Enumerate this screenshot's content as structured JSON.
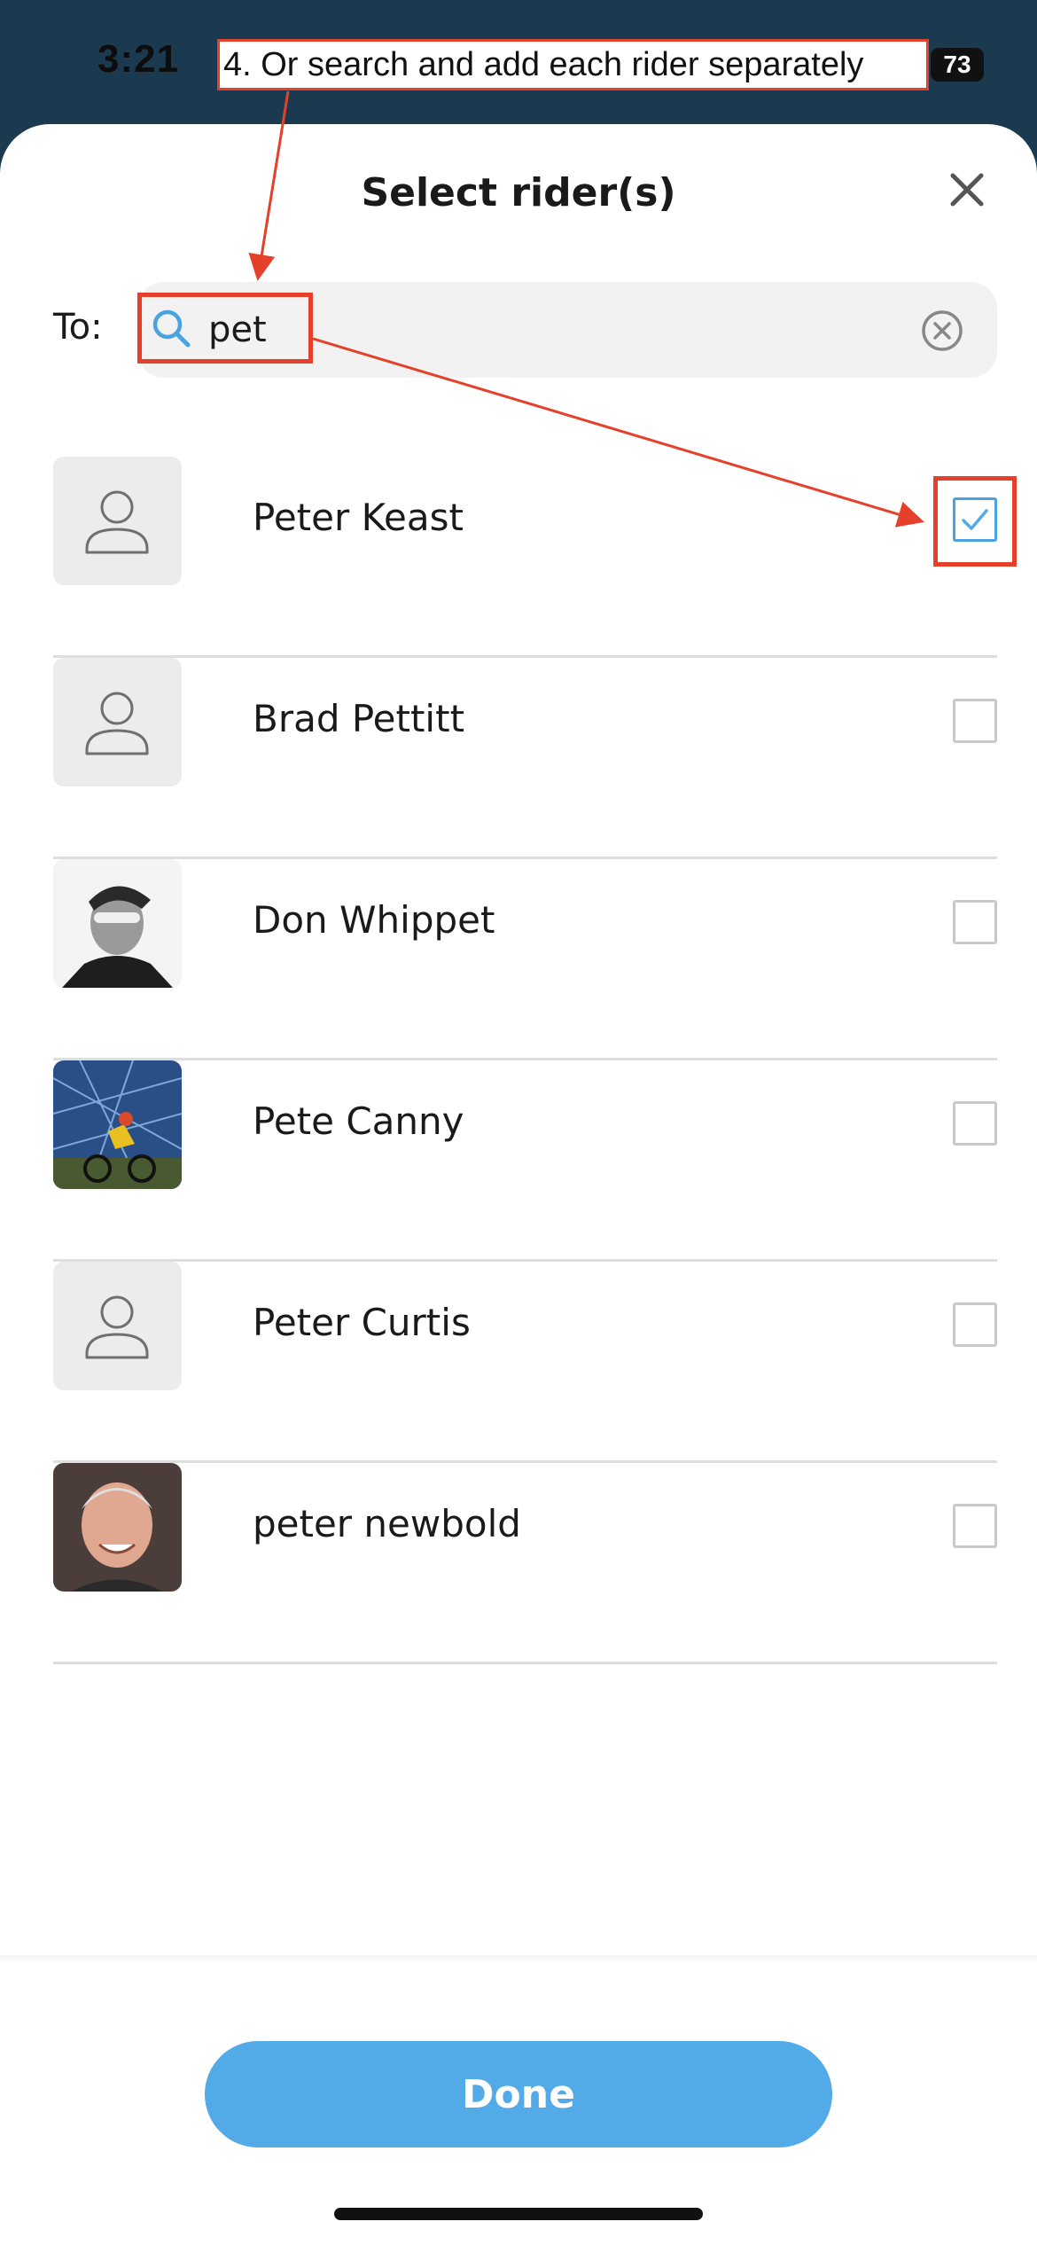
{
  "status_bar": {
    "time": "3:21",
    "battery": "73"
  },
  "annotation": {
    "text": "4. Or search and add each rider separately"
  },
  "sheet": {
    "title": "Select rider(s)"
  },
  "search": {
    "to_label": "To:",
    "query": "pet"
  },
  "riders": [
    {
      "name": "Peter Keast",
      "checked": true,
      "avatar": "placeholder"
    },
    {
      "name": "Brad Pettitt",
      "checked": false,
      "avatar": "placeholder"
    },
    {
      "name": "Don Whippet",
      "checked": false,
      "avatar": "photo"
    },
    {
      "name": "Pete Canny",
      "checked": false,
      "avatar": "photo"
    },
    {
      "name": "Peter Curtis",
      "checked": false,
      "avatar": "placeholder"
    },
    {
      "name": "peter newbold",
      "checked": false,
      "avatar": "photo"
    }
  ],
  "footer": {
    "done_label": "Done"
  },
  "colors": {
    "accent": "#52aae6",
    "annotation_red": "#e4402a",
    "header_bg": "#1b3a4f"
  }
}
